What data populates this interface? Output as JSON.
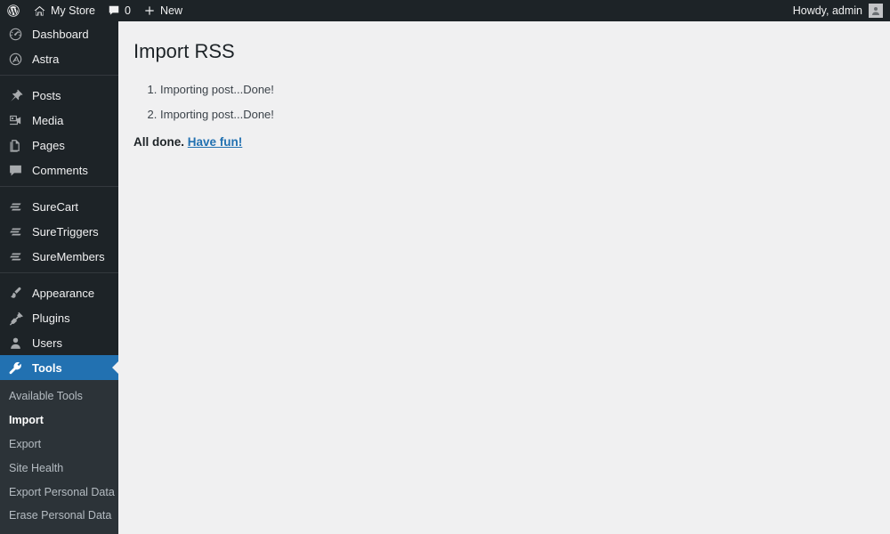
{
  "adminbar": {
    "wp_logo_icon": "wordpress-logo-icon",
    "site": {
      "icon": "home-icon",
      "label": "My Store"
    },
    "comments": {
      "icon": "comment-bubble-icon",
      "count": "0"
    },
    "new": {
      "icon": "plus-icon",
      "label": "New"
    },
    "account": {
      "greeting": "Howdy, admin",
      "avatar_icon": "user-avatar-icon"
    }
  },
  "sidebar": {
    "items": [
      {
        "label": "Dashboard",
        "icon": "dashboard-gauge-icon"
      },
      {
        "label": "Astra",
        "icon": "astra-logo-icon"
      },
      {
        "label": "Posts",
        "icon": "pin-icon"
      },
      {
        "label": "Media",
        "icon": "media-camera-icon"
      },
      {
        "label": "Pages",
        "icon": "pages-stack-icon"
      },
      {
        "label": "Comments",
        "icon": "comment-bubble-icon"
      },
      {
        "label": "SureCart",
        "icon": "surecart-bars-icon"
      },
      {
        "label": "SureTriggers",
        "icon": "suretriggers-bars-icon"
      },
      {
        "label": "SureMembers",
        "icon": "suremembers-bars-icon"
      },
      {
        "label": "Appearance",
        "icon": "paintbrush-icon"
      },
      {
        "label": "Plugins",
        "icon": "plug-icon"
      },
      {
        "label": "Users",
        "icon": "user-icon"
      },
      {
        "label": "Tools",
        "icon": "wrench-icon"
      }
    ],
    "submenu": [
      {
        "label": "Available Tools",
        "current": false
      },
      {
        "label": "Import",
        "current": true
      },
      {
        "label": "Export",
        "current": false
      },
      {
        "label": "Site Health",
        "current": false
      },
      {
        "label": "Export Personal Data",
        "current": false
      },
      {
        "label": "Erase Personal Data",
        "current": false
      }
    ]
  },
  "main": {
    "title": "Import RSS",
    "log_items": [
      "Importing post...Done!",
      "Importing post...Done!"
    ],
    "done_text": "All done.",
    "done_link": "Have fun!"
  },
  "colors": {
    "admin_blue": "#2271b1",
    "sidebar_bg": "#1d2327",
    "submenu_bg": "#2c3338",
    "content_bg": "#f0f0f1",
    "link": "#2271b1"
  }
}
